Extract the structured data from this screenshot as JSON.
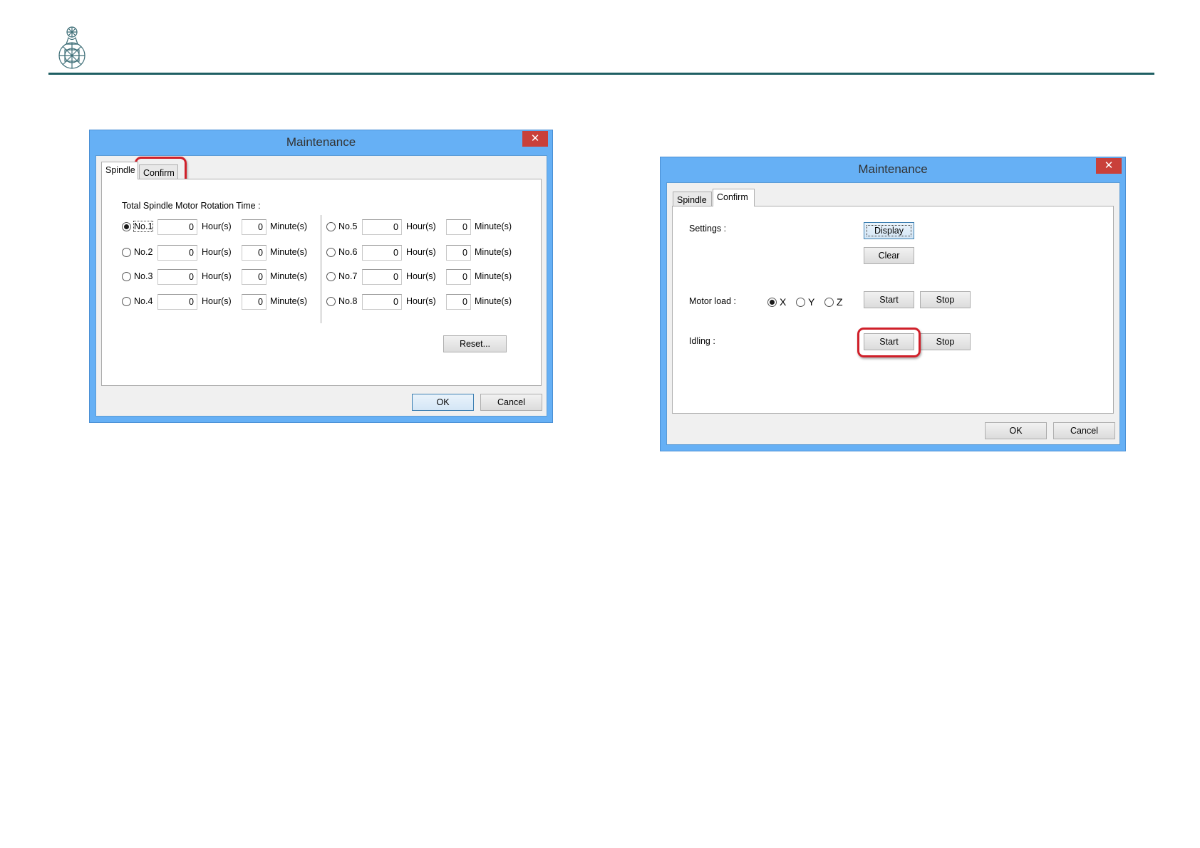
{
  "logo": {
    "icon": "roland-dg-emblem-icon"
  },
  "dialog1": {
    "title": "Maintenance",
    "close_glyph": "✕",
    "tabs": [
      "Spindle",
      "Confirm"
    ],
    "section_label": "Total Spindle Motor Rotation Time :",
    "hours_unit": "Hour(s)",
    "minutes_unit": "Minute(s)",
    "spindles": [
      {
        "label": "No.1",
        "hours": "0",
        "minutes": "0",
        "selected": true
      },
      {
        "label": "No.2",
        "hours": "0",
        "minutes": "0",
        "selected": false
      },
      {
        "label": "No.3",
        "hours": "0",
        "minutes": "0",
        "selected": false
      },
      {
        "label": "No.4",
        "hours": "0",
        "minutes": "0",
        "selected": false
      },
      {
        "label": "No.5",
        "hours": "0",
        "minutes": "0",
        "selected": false
      },
      {
        "label": "No.6",
        "hours": "0",
        "minutes": "0",
        "selected": false
      },
      {
        "label": "No.7",
        "hours": "0",
        "minutes": "0",
        "selected": false
      },
      {
        "label": "No.8",
        "hours": "0",
        "minutes": "0",
        "selected": false
      }
    ],
    "reset_label": "Reset...",
    "ok_label": "OK",
    "cancel_label": "Cancel"
  },
  "dialog2": {
    "title": "Maintenance",
    "close_glyph": "✕",
    "tabs": [
      "Spindle",
      "Confirm"
    ],
    "settings_label": "Settings :",
    "display_label": "Display",
    "clear_label": "Clear",
    "motor_load_label": "Motor load :",
    "axes": [
      {
        "label": "X",
        "selected": true
      },
      {
        "label": "Y",
        "selected": false
      },
      {
        "label": "Z",
        "selected": false
      }
    ],
    "motor_start_label": "Start",
    "motor_stop_label": "Stop",
    "idling_label": "Idling :",
    "idling_start_label": "Start",
    "idling_stop_label": "Stop",
    "ok_label": "OK",
    "cancel_label": "Cancel"
  },
  "colors": {
    "highlight": "#d0202a",
    "title_bar": "#66b0f5",
    "close_button": "#c9403a",
    "header_rule": "#1f5f63"
  }
}
